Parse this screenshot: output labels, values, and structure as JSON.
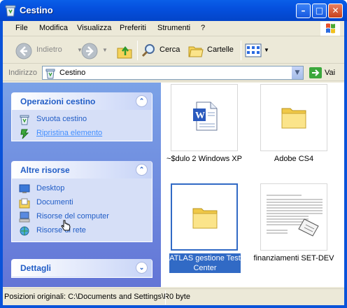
{
  "window": {
    "title": "Cestino"
  },
  "menu": [
    "File",
    "Modifica",
    "Visualizza",
    "Preferiti",
    "Strumenti",
    "?"
  ],
  "toolbar": {
    "back": "Indietro",
    "search": "Cerca",
    "folders": "Cartelle"
  },
  "address": {
    "label": "Indirizzo",
    "value": "Cestino",
    "go": "Vai"
  },
  "tasks": {
    "title": "Operazioni cestino",
    "items": [
      "Svuota cestino",
      "Ripristina elemento"
    ]
  },
  "other": {
    "title": "Altre risorse",
    "items": [
      "Desktop",
      "Documenti",
      "Risorse del computer",
      "Risorse di rete"
    ]
  },
  "details": {
    "title": "Dettagli"
  },
  "files": [
    {
      "name": "~$dulo 2 Windows XP",
      "icon": "word-document-icon"
    },
    {
      "name": "Adobe CS4",
      "icon": "folder-icon"
    },
    {
      "name": "ATLAS gestione Test Center",
      "icon": "folder-icon",
      "selected": true
    },
    {
      "name": "finanziamenti SET-DEV",
      "icon": "document-thumbnail"
    }
  ],
  "status": {
    "location": "Posizioni originali: C:\\Documents and Settings\\R",
    "size": "0 byte"
  }
}
